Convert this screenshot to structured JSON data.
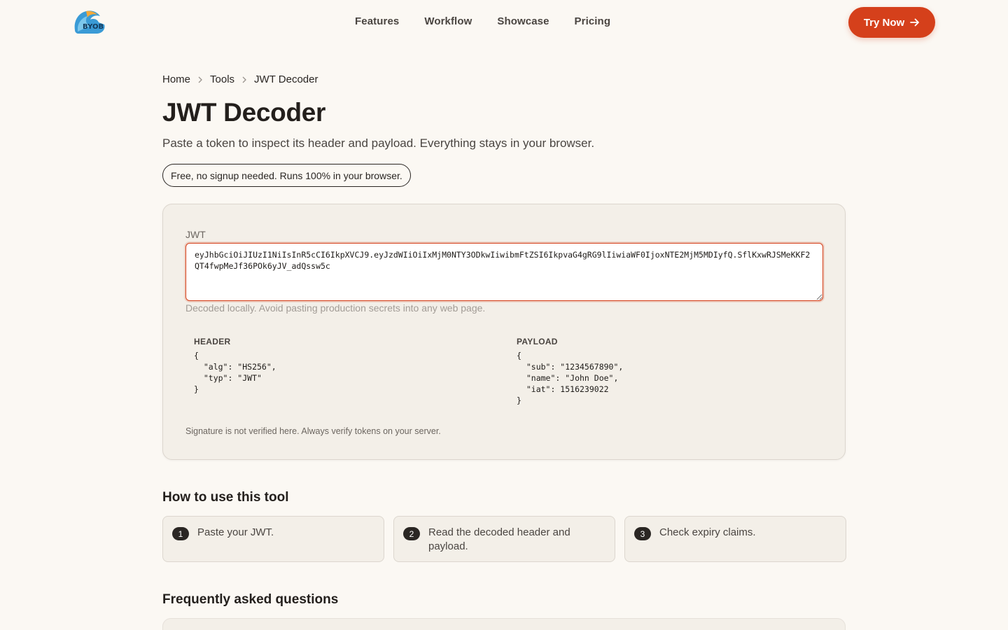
{
  "nav": {
    "logo_text": "BYOB",
    "links": [
      "Features",
      "Workflow",
      "Showcase",
      "Pricing"
    ],
    "cta_label": "Try Now",
    "cta_icon": "arrow-right-icon"
  },
  "breadcrumb": [
    "Home",
    "Tools",
    "JWT Decoder"
  ],
  "page": {
    "title": "JWT Decoder",
    "subtitle": "Paste a token to inspect its header and payload. Everything stays in your browser.",
    "badge": "Free, no signup needed. Runs 100% in your browser."
  },
  "tool": {
    "input_label": "JWT",
    "input_value": "eyJhbGciOiJIUzI1NiIsInR5cCI6IkpXVCJ9.eyJzdWIiOiIxMjM0NTY3ODkwIiwibmFtZSI6IkpvaG4gRG9lIiwiaWF0IjoxNTE2MjM5MDIyfQ.SflKxwRJSMeKKF2QT4fwpMeJf36POk6yJV_adQssw5c",
    "hint": "Decoded locally. Avoid pasting production secrets into any web page.",
    "header_label": "HEADER",
    "header_json": "{\n  \"alg\": \"HS256\",\n  \"typ\": \"JWT\"\n}",
    "payload_label": "PAYLOAD",
    "payload_json": "{\n  \"sub\": \"1234567890\",\n  \"name\": \"John Doe\",\n  \"iat\": 1516239022\n}",
    "signature_note": "Signature is not verified here. Always verify tokens on your server."
  },
  "how_to": {
    "heading": "How to use this tool",
    "steps": [
      {
        "num": "1",
        "text": "Paste your JWT."
      },
      {
        "num": "2",
        "text": "Read the decoded header and payload."
      },
      {
        "num": "3",
        "text": "Check expiry claims."
      }
    ]
  },
  "faq": {
    "heading": "Frequently asked questions"
  },
  "colors": {
    "accent": "#d5401b",
    "background": "#fbf8f3",
    "card": "#f3efe8",
    "text": "#231f1c"
  }
}
